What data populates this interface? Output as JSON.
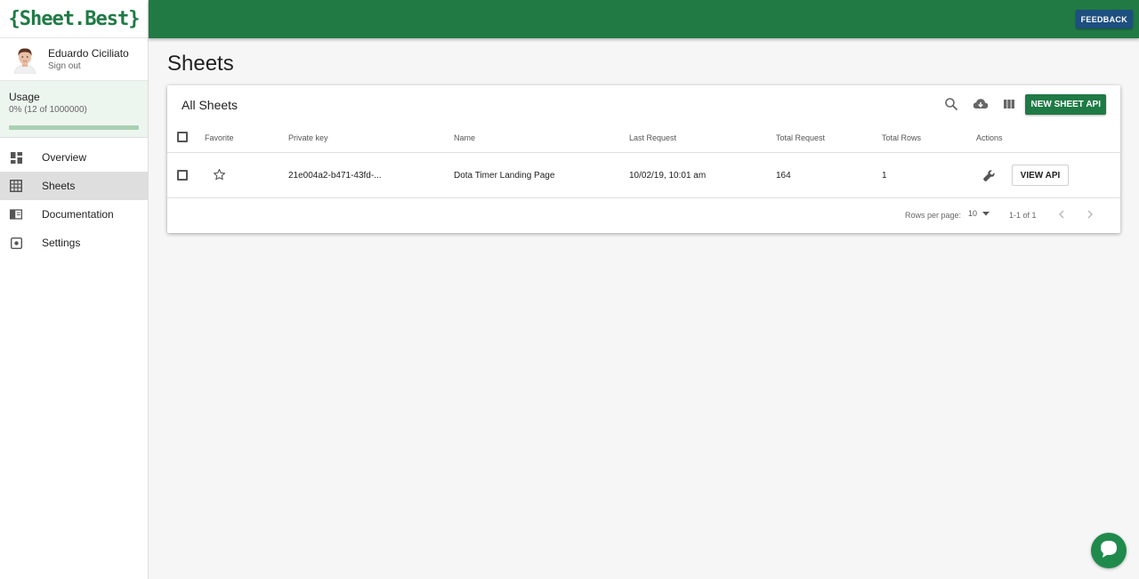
{
  "app": {
    "logo_text": "{Sheet.Best}",
    "brand_color": "#217a44"
  },
  "topbar": {
    "feedback_label": "FEEDBACK"
  },
  "user": {
    "name": "Eduardo Ciciliato",
    "signout_label": "Sign out"
  },
  "usage": {
    "title": "Usage",
    "detail": "0% (12 of 1000000)",
    "fraction": 0.0
  },
  "nav": {
    "items": [
      {
        "label": "Overview",
        "icon": "dashboard-icon",
        "active": false
      },
      {
        "label": "Sheets",
        "icon": "grid-icon",
        "active": true
      },
      {
        "label": "Documentation",
        "icon": "book-icon",
        "active": false
      },
      {
        "label": "Settings",
        "icon": "settings-icon",
        "active": false
      }
    ]
  },
  "page": {
    "title": "Sheets"
  },
  "card": {
    "title": "All Sheets",
    "new_api_label": "NEW SHEET API",
    "columns": [
      "Favorite",
      "Private key",
      "Name",
      "Last Request",
      "Total Request",
      "Total Rows",
      "Actions"
    ],
    "rows": [
      {
        "private_key": "21e004a2-b471-43fd-...",
        "name": "Dota Timer Landing Page",
        "last_request": "10/02/19, 10:01 am",
        "total_request": "164",
        "total_rows": "1",
        "view_label": "VIEW API"
      }
    ],
    "footer": {
      "rows_per_page_label": "Rows per page:",
      "rows_per_page": "10",
      "range": "1-1 of 1"
    }
  }
}
